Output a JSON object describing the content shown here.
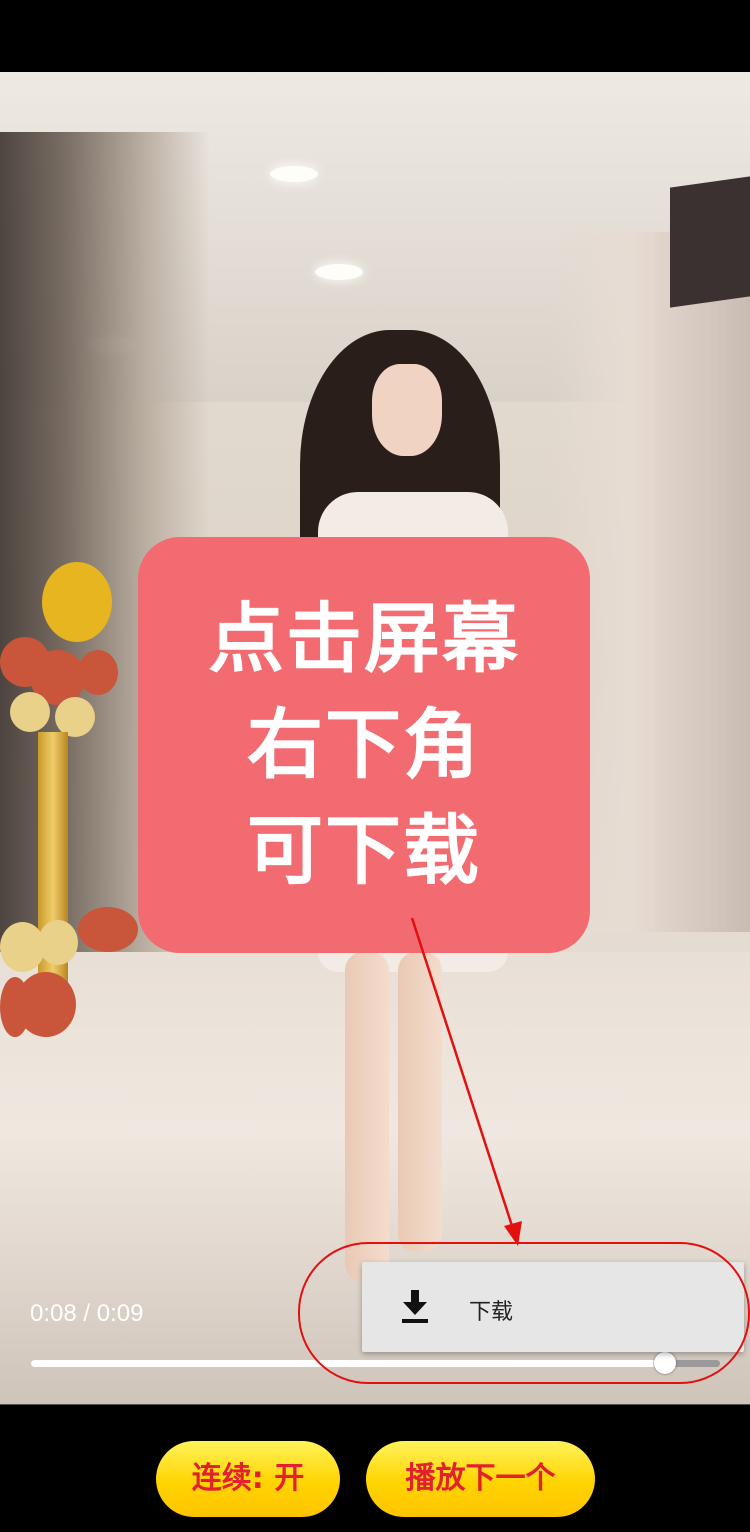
{
  "video": {
    "overlay_lines": [
      "点击屏幕",
      "右下角",
      "可下载"
    ],
    "time_display": "0:08 / 0:09",
    "progress_fraction": 0.92
  },
  "download_menu": {
    "label": "下载",
    "icon": "download-icon"
  },
  "bottom_bar": {
    "autoplay_label": "连续: 开",
    "next_label": "播放下一个"
  },
  "colors": {
    "overlay_card": "#f16b70",
    "annotation": "#e31010",
    "pill_text": "#e2212e",
    "pill_bg": "#ffd400"
  }
}
